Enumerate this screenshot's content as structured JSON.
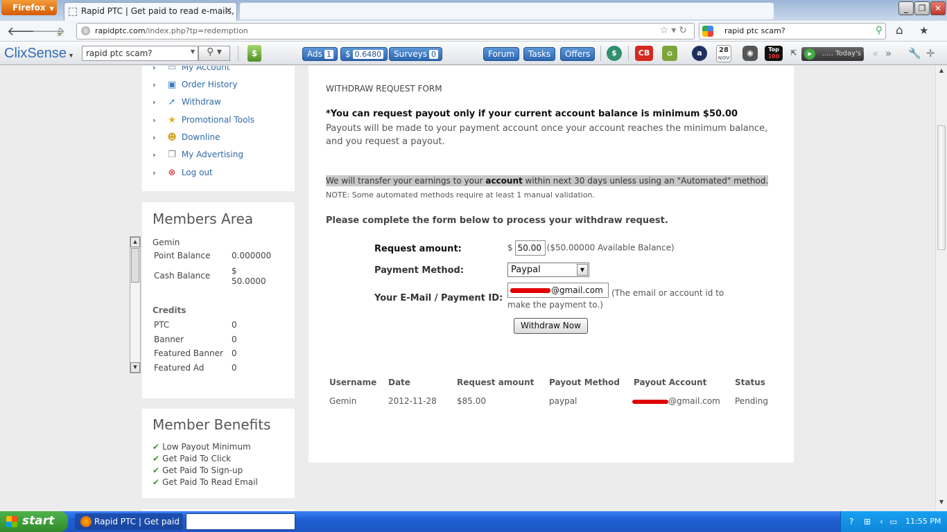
{
  "browser": {
    "menu_label": "Firefox",
    "tab_title": "Rapid PTC | Get paid to read e-mails, click...",
    "url_host": "rapidptc.com",
    "url_path": "/index.php?tp=redemption",
    "search_query": "rapid ptc scam?"
  },
  "toolbar": {
    "logo": "ClixSense",
    "search_query": "rapid ptc scam?",
    "ads_label": "Ads",
    "ads_count": "1",
    "cash_label": "$",
    "cash_value": "0.6480",
    "surveys_label": "Surveys",
    "surveys_count": "0",
    "forum_label": "Forum",
    "tasks_label": "Tasks",
    "offers_label": "Offers",
    "cb_label": "CB",
    "amazon_label": "a",
    "calendar_day": "28",
    "calendar_month": "NOV",
    "top100_line1": "Top",
    "top100_line2": "100",
    "player_text": "..... Today's Top"
  },
  "sidebar": {
    "menu": [
      {
        "label": "My Account",
        "icon": "account-icon"
      },
      {
        "label": "Order History",
        "icon": "order-history-icon"
      },
      {
        "label": "Withdraw",
        "icon": "withdraw-icon"
      },
      {
        "label": "Promotional Tools",
        "icon": "star-icon"
      },
      {
        "label": "Downline",
        "icon": "downline-icon"
      },
      {
        "label": "My Advertising",
        "icon": "advertising-icon"
      },
      {
        "label": "Log out",
        "icon": "logout-icon"
      }
    ],
    "members": {
      "title": "Members Area",
      "username": "Gemin",
      "point_balance_label": "Point Balance",
      "point_balance": "0.000000",
      "cash_balance_label": "Cash Balance",
      "cash_balance_currency": "$",
      "cash_balance": "50.0000",
      "credits_label": "Credits",
      "credits": [
        {
          "label": "PTC",
          "value": "0"
        },
        {
          "label": "Banner",
          "value": "0"
        },
        {
          "label": "Featured Banner",
          "value": "0"
        },
        {
          "label": "Featured Ad",
          "value": "0"
        }
      ]
    },
    "benefits": {
      "title": "Member Benefits",
      "items": [
        "Low Payout Minimum",
        "Get Paid To Click",
        "Get Paid To Sign-up",
        "Get Paid To Read Email"
      ]
    }
  },
  "content": {
    "form_title": "WITHDRAW REQUEST FORM",
    "min_notice": "*You can request payout only if your current account balance is minimum $50.00",
    "payout_desc": "Payouts will be made to your payment account once your account reaches the minimum balance, and you request a payout.",
    "transfer_pre": "We will transfer your earnings to your ",
    "transfer_bold": "account",
    "transfer_post": " within next 30 days unless using an \"Automated\" method.",
    "note": "NOTE: Some automated methods require at least 1 manual validation.",
    "complete": "Please complete the form below to process your withdraw request.",
    "form": {
      "amount_label": "Request amount:",
      "currency": "$",
      "amount_value": "50.00",
      "available": "($50.00000 Available Balance)",
      "method_label": "Payment Method:",
      "method_value": "Paypal",
      "email_label": "Your E-Mail / Payment ID:",
      "email_value": "@gmail.com",
      "email_hint_1": "(The email or account id to",
      "email_hint_2": "make the payment to.)",
      "submit_label": "Withdraw Now"
    },
    "history": {
      "headers": [
        "Username",
        "Date",
        "Request amount",
        "Payout Method",
        "Payout Account",
        "Status"
      ],
      "rows": [
        [
          "Gemin",
          "2012-11-28",
          "$85.00",
          "paypal",
          "@gmail.com",
          "Pending"
        ]
      ]
    }
  },
  "taskbar": {
    "start_label": "start",
    "task_label": "Rapid PTC | Get paid ...",
    "clock": "11:55 PM"
  }
}
